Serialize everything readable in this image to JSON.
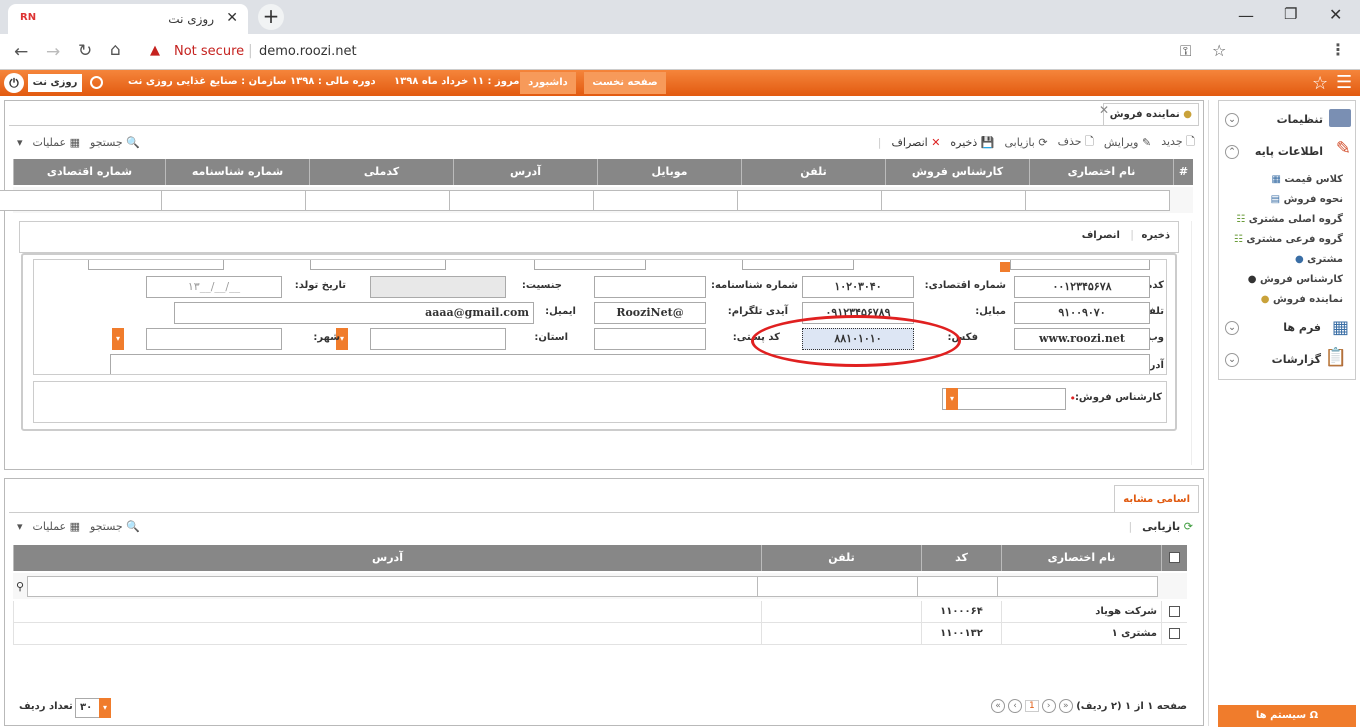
{
  "browser": {
    "tab_title": "روزی نت",
    "url_warning": "Not secure",
    "url": "demo.roozi.net"
  },
  "topnav": {
    "home": "صفحه نخست",
    "dashboard": "داشبورد",
    "today": "امروز : ۱۱ خرداد ماه ۱۳۹۸",
    "fiscal": "دوره مالی : ۱۳۹۸",
    "org": "سازمان : صنایع غذایی روزی نت",
    "user": "روزی نت"
  },
  "sidebar": {
    "settings": "تنظیمات",
    "base_info": "اطلاعات پایه",
    "items": [
      "کلاس قیمت",
      "نحوه فروش",
      "گروه اصلی مشتری",
      "گروه فرعی مشتری",
      "مشتری",
      "کارشناس فروش",
      "نماینده فروش"
    ],
    "forms": "فرم ها",
    "reports": "گزارشات",
    "systems": "سیستم ها"
  },
  "page_tab": "نماینده فروش",
  "toolbar": {
    "new": "جدید",
    "edit": "ویرایش",
    "delete": "حذف",
    "refresh": "بازیابی",
    "save": "ذخیره",
    "cancel": "انصراف",
    "search": "جستجو",
    "ops": "عملیات"
  },
  "grid": {
    "columns": [
      "نام اختصاری",
      "کارشناس فروش",
      "تلفن",
      "موبایل",
      "آدرس",
      "کدملی",
      "شماره شناسنامه",
      "شماره اقتصادی"
    ]
  },
  "form": {
    "save": "ذخیره",
    "cancel": "انصراف",
    "labels": {
      "national_code": "کدملی:",
      "economic_no": "شماره اقتصادی:",
      "id_no": "شماره شناسنامه:",
      "gender": "جنسیت:",
      "birth": "تاریخ تولد:",
      "phone": "تلفن:",
      "mobile": "مبایل:",
      "telegram": "آیدی تلگرام:",
      "email": "ایمیل:",
      "website": "وب سایت:",
      "fax": "فکس:",
      "postal": "کد پستی:",
      "province": "استان:",
      "city": "شهر:",
      "address": "آدرس:",
      "sales_expert": "کارشناس فروش:"
    },
    "values": {
      "national_code": "۰۰۱۲۳۴۵۶۷۸",
      "economic_no": "۱۰۲۰۳۰۴۰",
      "phone": "۹۱۰۰۹۰۷۰",
      "mobile": "۰۹۱۲۳۴۵۶۷۸۹",
      "telegram": "RooziNet@",
      "email": "aaaa@gmail.com",
      "website": "www.roozi.net",
      "fax": "۸۸۱۰۱۰۱۰",
      "birth": "۱۳__/__/__"
    }
  },
  "similar": {
    "tab": "اسامی مشابه",
    "refresh": "بازیابی",
    "search": "جستجو",
    "ops": "عملیات",
    "columns": [
      "نام اختصاری",
      "کد",
      "تلفن",
      "آدرس"
    ],
    "rows": [
      {
        "name": "شرکت هویاد",
        "code": "۱۱۰۰۰۶۴"
      },
      {
        "name": "مشتری ۱",
        "code": "۱۱۰۰۱۳۲"
      }
    ],
    "pager": "صفحه ۱ از ۱ (۲ ردیف)",
    "page": "1",
    "rows_count_label": "تعداد ردیف",
    "rows_count": "۳۰"
  }
}
